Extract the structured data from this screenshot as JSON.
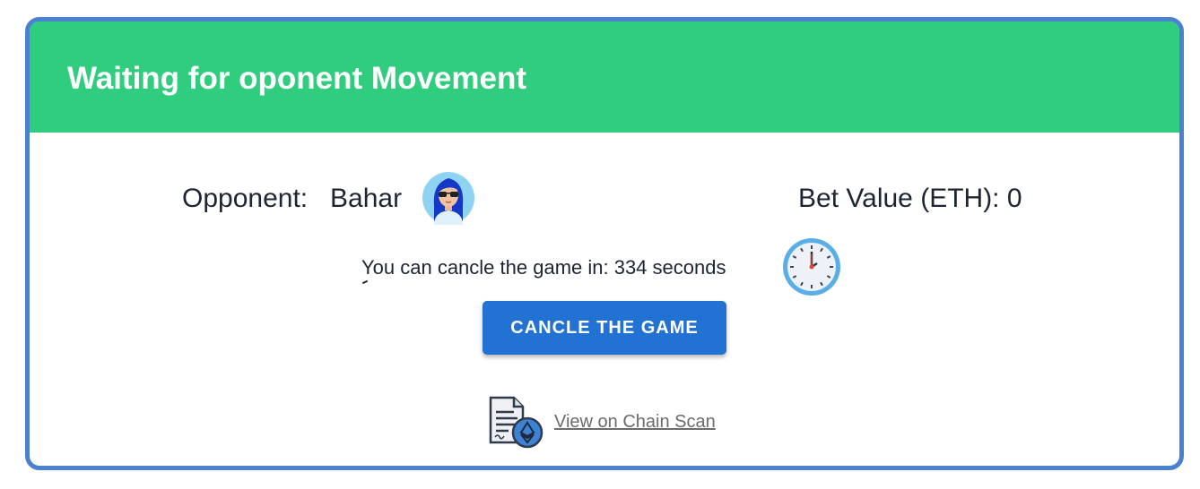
{
  "header": {
    "title": "Waiting for oponent Movement",
    "background_color": "#31cd7e"
  },
  "opponent": {
    "label": "Opponent:",
    "name": "Bahar",
    "avatar_icon": "avatar-woman-sunglasses-icon"
  },
  "bet": {
    "label": "Bet Value (ETH): 0"
  },
  "cancel_info": {
    "text": "You can cancle the game in: 334 seconds",
    "icon": "clock-icon"
  },
  "cancel_button": {
    "label": "CANCLE THE GAME",
    "color": "#2272d4"
  },
  "chain_scan": {
    "link_text": "View on Chain Scan",
    "icon": "ethereum-document-icon"
  },
  "colors": {
    "card_border": "#4a80d0",
    "text": "#1d2433",
    "link": "#6b6b6b"
  }
}
